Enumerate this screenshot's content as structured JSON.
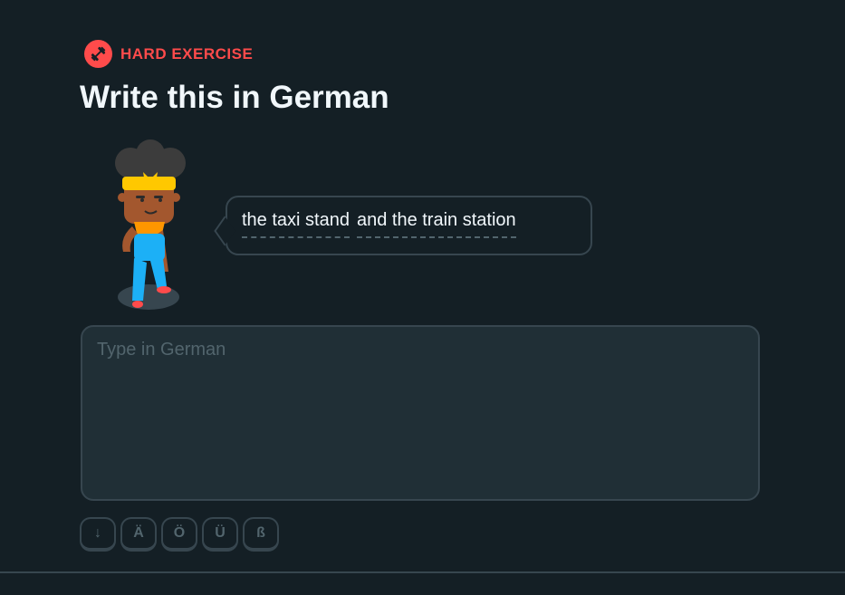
{
  "header": {
    "badge_label": "HARD EXERCISE",
    "badge_icon": "dumbbell-icon",
    "badge_color": "#ff4b4b"
  },
  "title": "Write this in German",
  "prompt": {
    "tokens": [
      "the taxi stand",
      "and the train station"
    ]
  },
  "answer": {
    "placeholder": "Type in German",
    "value": ""
  },
  "keyboard": {
    "keys": [
      "↓",
      "Ä",
      "Ö",
      "Ü",
      "ß"
    ]
  }
}
